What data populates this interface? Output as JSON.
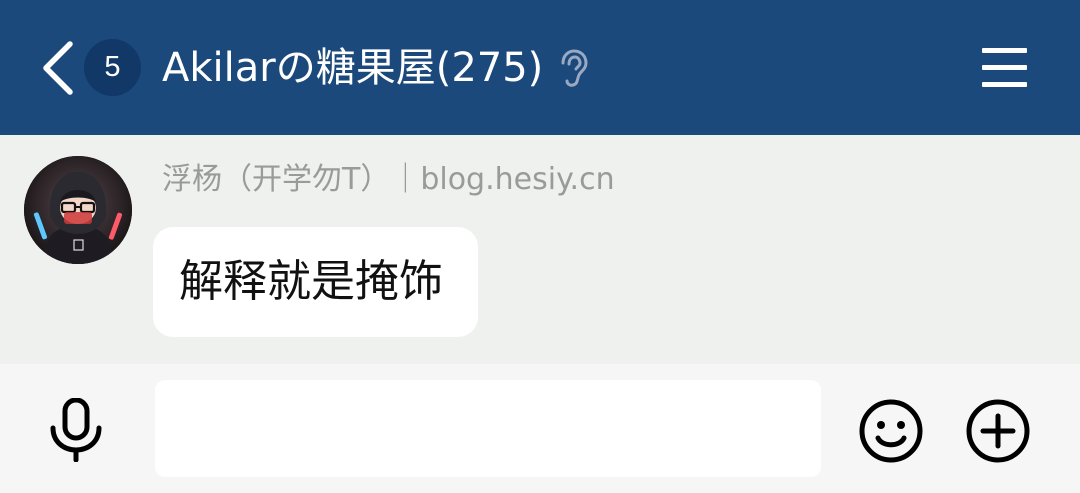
{
  "header": {
    "unread_count": "5",
    "title": "Akilarの糖果屋(275)",
    "icons": {
      "back": "chevron-left-icon",
      "mode": "ear-icon",
      "menu": "hamburger-menu-icon"
    }
  },
  "message": {
    "sender": "浮杨（开学勿T）｜blog.hesiy.cn",
    "text": "解释就是掩饰"
  },
  "input_bar": {
    "value": "",
    "placeholder": "",
    "icons": {
      "voice": "microphone-icon",
      "emoji": "smiley-icon",
      "more": "plus-circle-icon"
    }
  },
  "colors": {
    "header_bg": "#1c497c",
    "badge_bg": "#113866",
    "chat_bg": "#eef1ee",
    "input_bar_bg": "#f6f6f6",
    "sender_text": "#9a9a9a"
  }
}
